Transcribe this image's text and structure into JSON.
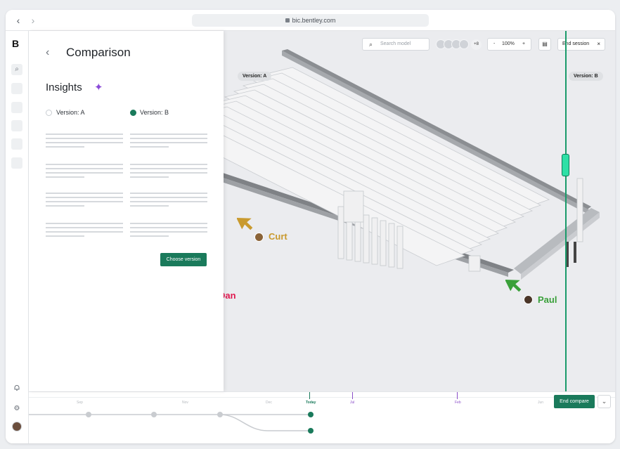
{
  "browser": {
    "url": "bic.bentley.com",
    "back_icon": "chevron-left-icon",
    "forward_icon": "chevron-right-icon"
  },
  "rail": {
    "logo": "B"
  },
  "panel": {
    "title": "Comparison",
    "insights_label": "Insights",
    "version_a": "Version: A",
    "version_b": "Version: B",
    "choose_version": "Choose version"
  },
  "viewport": {
    "search_placeholder": "Search model",
    "collaborators_more": "+8",
    "zoom_minus": "-",
    "zoom_level": "100%",
    "zoom_plus": "+",
    "end_session": "End session",
    "label_version_a": "Version: A",
    "label_version_b": "Version: B"
  },
  "cursors": [
    {
      "name": "Curt",
      "color": "#c99a2e"
    },
    {
      "name": "Dan",
      "color": "#e0194f"
    },
    {
      "name": "Paul",
      "color": "#3aa03a"
    }
  ],
  "timeline": {
    "end_compare": "End compare",
    "labels": {
      "t1": "Sep",
      "t2": "Nov",
      "t3": "Dec",
      "today": "Today",
      "jul": "Jul",
      "feb": "Feb",
      "t8": "Jun"
    }
  },
  "colors": {
    "accent": "#1a7a5b",
    "split": "#1a9a6a",
    "handle": "#2ee0a6",
    "sparkle": "#8a4ad8"
  }
}
